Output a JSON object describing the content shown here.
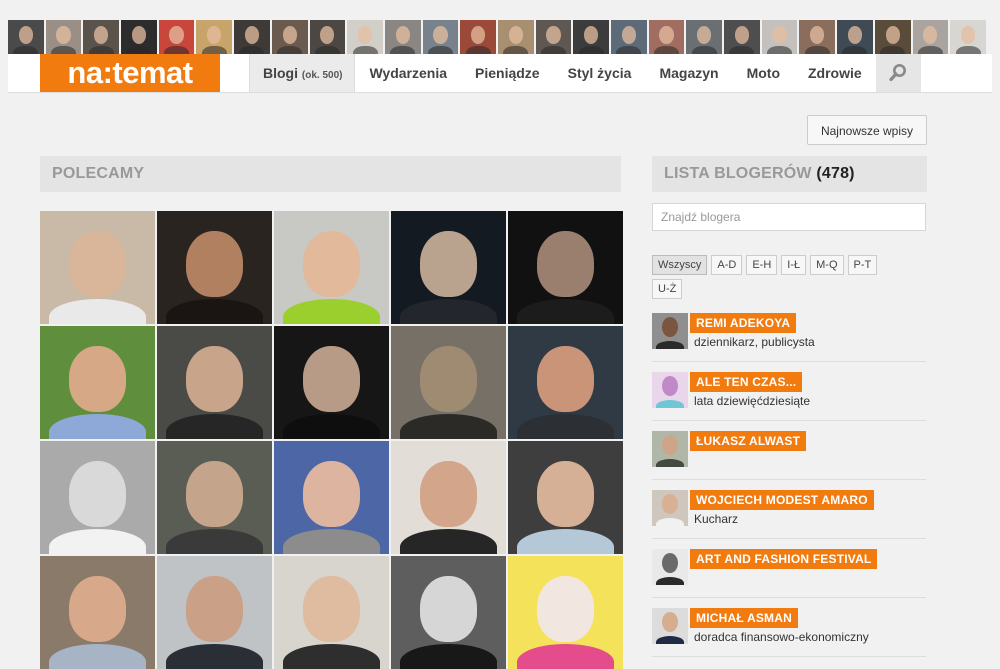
{
  "top_strip": {
    "avatars": [
      "#4a4a4a",
      "#9a8f86",
      "#5a534c",
      "#2c2c2c",
      "#c8463c",
      "#c7a46a",
      "#3d3a37",
      "#6b5a4f",
      "#4c4742",
      "#d2cfc9",
      "#8a8683",
      "#78828c",
      "#9b4a3a",
      "#a88f70",
      "#5e5752",
      "#3c3c3c",
      "#5d6a78",
      "#a06d60",
      "#6a6f74",
      "#4e4e4e",
      "#c4c0bd",
      "#8a6d5c",
      "#3f4a55",
      "#5a4c3a",
      "#a9a49f",
      "#d8d6d3"
    ]
  },
  "header": {
    "logo_text": "na:temat",
    "nav": [
      {
        "label": "Blogi",
        "suffix": "(ok. 500)",
        "active": true
      },
      {
        "label": "Wydarzenia"
      },
      {
        "label": "Pieniądze"
      },
      {
        "label": "Styl życia"
      },
      {
        "label": "Magazyn"
      },
      {
        "label": "Moto"
      },
      {
        "label": "Zdrowie"
      }
    ],
    "search_icon": "search-icon"
  },
  "newest_button": "Najnowsze wpisy",
  "recommended": {
    "title": "POLECAMY",
    "tiles": [
      {
        "bg": "#c9b9a7",
        "face": "#d9b69a",
        "body": "#e9e9e9"
      },
      {
        "bg": "#2a2420",
        "face": "#b08060",
        "body": "#1a1512"
      },
      {
        "bg": "#c8c8c4",
        "face": "#e2b99a",
        "body": "#9bcf2e"
      },
      {
        "bg": "#141a22",
        "face": "#b9a38e",
        "body": "#23272d"
      },
      {
        "bg": "#111111",
        "face": "#9a7e6e",
        "body": "#1c1c1c"
      },
      {
        "bg": "#5f8f3d",
        "face": "#d6a886",
        "body": "#8ea8d8"
      },
      {
        "bg": "#4a4a46",
        "face": "#c8a58a",
        "body": "#262626"
      },
      {
        "bg": "#161616",
        "face": "#b89b86",
        "body": "#0e0e0e"
      },
      {
        "bg": "#777066",
        "face": "#9f8a72",
        "body": "#2b2a27"
      },
      {
        "bg": "#2f3a45",
        "face": "#c99478",
        "body": "#2c2f34"
      },
      {
        "bg": "#aaaaaa",
        "face": "#d9d9d9",
        "body": "#f2f2f2"
      },
      {
        "bg": "#595d54",
        "face": "#c5a48c",
        "body": "#3a3a3a"
      },
      {
        "bg": "#4c66a6",
        "face": "#ddb4a0",
        "body": "#8c8c8c"
      },
      {
        "bg": "#e2ddd6",
        "face": "#d3a58a",
        "body": "#262626"
      },
      {
        "bg": "#3e3e3e",
        "face": "#d5b096",
        "body": "#b5c8d8"
      },
      {
        "bg": "#8a7a6a",
        "face": "#d8a88a",
        "body": "#a7b4c6"
      },
      {
        "bg": "#bfc3c6",
        "face": "#caa187",
        "body": "#2a2f35"
      },
      {
        "bg": "#d7d5cd",
        "face": "#dfbca0",
        "body": "#2e2e2e"
      },
      {
        "bg": "#5e5e5e",
        "face": "#d6d6d6",
        "body": "#181818"
      },
      {
        "bg": "#f4e35a",
        "face": "#f2e6e0",
        "body": "#e44c8c"
      }
    ]
  },
  "bloggers": {
    "title": "LISTA BLOGERÓW",
    "count": "(478)",
    "search_placeholder": "Znajdź blogera",
    "filters": [
      "Wszyscy",
      "A-D",
      "E-H",
      "I-Ł",
      "M-Q",
      "P-T",
      "U-Ż"
    ],
    "items": [
      {
        "name": "REMI ADEKOYA",
        "desc": "dziennikarz, publicysta",
        "bg": "#8f8f8f",
        "face": "#7a5540",
        "body": "#2a2a2a"
      },
      {
        "name": "ALE TEN CZAS...",
        "desc": "lata dziewięćdziesiąte",
        "bg": "#ead6ea",
        "face": "#c08ac8",
        "body": "#6fc6d6"
      },
      {
        "name": "ŁUKASZ ALWAST",
        "desc": "",
        "bg": "#b0b6a8",
        "face": "#cfa58a",
        "body": "#454a40"
      },
      {
        "name": "WOJCIECH MODEST AMARO",
        "desc": "Kucharz",
        "bg": "#cfc6bd",
        "face": "#d8b194",
        "body": "#f1f1f1"
      },
      {
        "name": "ART AND FASHION FESTIVAL",
        "desc": "",
        "bg": "#e9e9e9",
        "face": "#6a6a6a",
        "body": "#2b2b2b"
      },
      {
        "name": "MICHAŁ ASMAN",
        "desc": "doradca finansowo-ekonomiczny",
        "bg": "#dcdcdc",
        "face": "#d7ad90",
        "body": "#1f2a44"
      }
    ]
  }
}
